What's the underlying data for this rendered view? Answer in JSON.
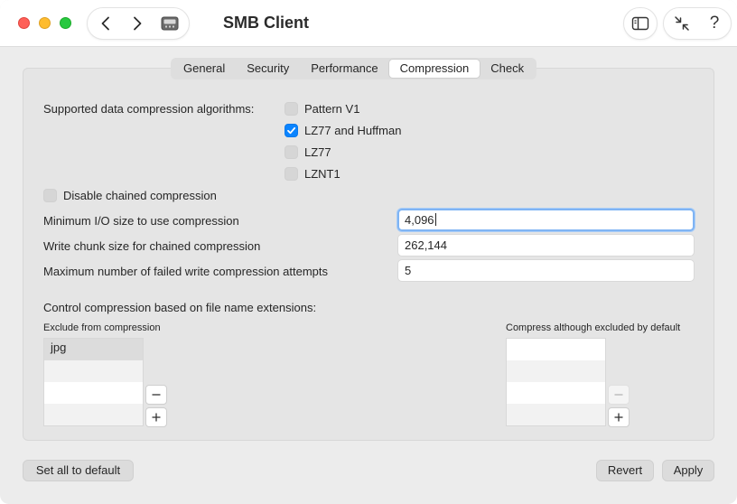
{
  "window": {
    "title": "SMB Client",
    "colors": {
      "close": "#fe5f57",
      "minimize": "#febc2e",
      "maximize": "#28c840",
      "accent": "#0a84ff"
    }
  },
  "toolbar": {
    "back_icon": "chevron-left-icon",
    "forward_icon": "chevron-right-icon",
    "app_icon": "smb-drive-icon",
    "sidebar_icon": "sidebar-icon",
    "collapse_icon": "arrows-collapse-icon",
    "help_label": "?"
  },
  "tabs": [
    {
      "label": "General",
      "selected": false
    },
    {
      "label": "Security",
      "selected": false
    },
    {
      "label": "Performance",
      "selected": false
    },
    {
      "label": "Compression",
      "selected": true
    },
    {
      "label": "Check",
      "selected": false
    }
  ],
  "compression": {
    "algorithms_label": "Supported data compression algorithms:",
    "algorithms": [
      {
        "label": "Pattern V1",
        "checked": false
      },
      {
        "label": "LZ77 and Huffman",
        "checked": true
      },
      {
        "label": "LZ77",
        "checked": false
      },
      {
        "label": "LZNT1",
        "checked": false
      }
    ],
    "disable_chained": {
      "label": "Disable chained compression",
      "checked": false
    },
    "fields": [
      {
        "label": "Minimum I/O size to use compression",
        "value": "4,096",
        "focused": true
      },
      {
        "label": "Write chunk size for chained compression",
        "value": "262,144",
        "focused": false
      },
      {
        "label": "Maximum number of failed write compression attempts",
        "value": "5",
        "focused": false
      }
    ],
    "extensions_label": "Control compression based on file name extensions:",
    "exclude": {
      "label": "Exclude from compression",
      "items": [
        "jpg"
      ]
    },
    "include": {
      "label": "Compress although excluded by default",
      "items": []
    },
    "add_label": "+",
    "remove_label": "−"
  },
  "footer": {
    "default_label": "Set all to default",
    "revert_label": "Revert",
    "apply_label": "Apply"
  }
}
